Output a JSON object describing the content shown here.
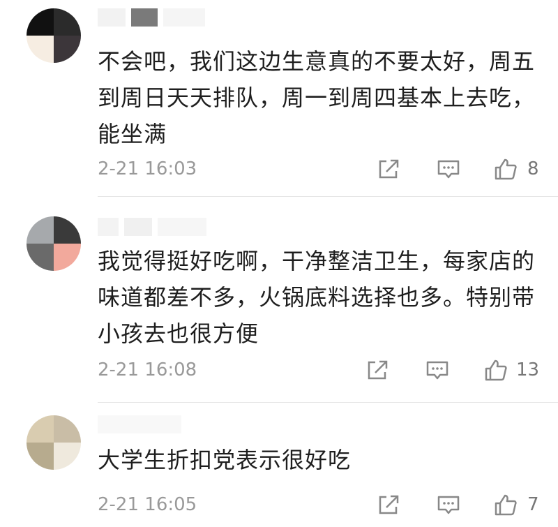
{
  "comments": [
    {
      "lines": [
        "不会吧，我们这边生意真的不要太好，周五",
        "到周日天天排队，周一到周四基本上去吃，",
        "能坐满"
      ],
      "time": "2-21 16:03",
      "likes": "8"
    },
    {
      "lines": [
        "我觉得挺好吃啊，干净整洁卫生，每家店的",
        "味道都差不多，火锅底料选择也多。特别带",
        "小孩去也很方便"
      ],
      "time": "2-21 16:08",
      "likes": "13"
    },
    {
      "lines": [
        "大学生折扣党表示很好吃"
      ],
      "time": "2-21 16:05",
      "likes": "7"
    }
  ],
  "colors": {
    "icon": "#888888",
    "divider": "#e6e6e6"
  }
}
